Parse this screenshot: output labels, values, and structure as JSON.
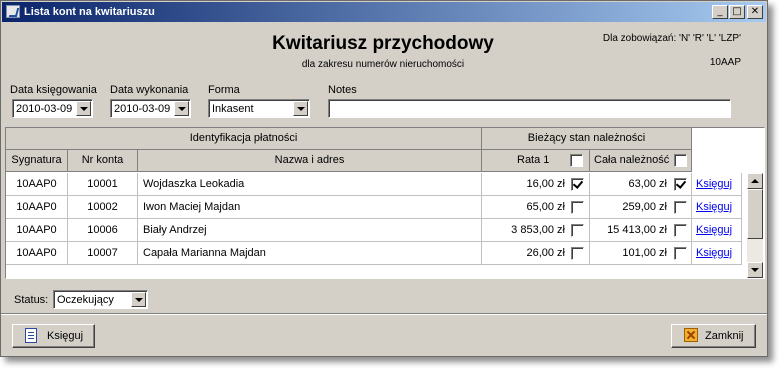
{
  "window": {
    "title": "Lista kont na kwitariuszu"
  },
  "header": {
    "title": "Kwitariusz przychodowy",
    "subtitle": "dla zakresu numerów nieruchomości",
    "obligations": "Dla zobowiązań: 'N' 'R' 'L' 'LZP'",
    "code": "10AAP"
  },
  "filters": {
    "posting_date": {
      "label": "Data księgowania",
      "value": "2010-03-09"
    },
    "execution_date": {
      "label": "Data wykonania",
      "value": "2010-03-09"
    },
    "form": {
      "label": "Forma",
      "value": "Inkasent"
    },
    "notes": {
      "label": "Notes",
      "value": ""
    }
  },
  "table": {
    "group_headers": {
      "identification": "Identyfikacja płatności",
      "current_state": "Bieżący stan należności"
    },
    "columns": {
      "signature": "Sygnatura",
      "account_no": "Nr konta",
      "name_address": "Nazwa i adres",
      "installment": "Rata 1",
      "total": "Cała należność"
    },
    "rows": [
      {
        "signature": "10AAP0",
        "account_no": "10001",
        "name": "Wojdaszka Leokadia",
        "installment": "16,00 zł",
        "installment_checked": true,
        "total": "63,00 zł",
        "total_checked": true,
        "action": "Księguj"
      },
      {
        "signature": "10AAP0",
        "account_no": "10002",
        "name": "Iwon Maciej Majdan",
        "installment": "65,00 zł",
        "installment_checked": false,
        "total": "259,00 zł",
        "total_checked": false,
        "action": "Księguj"
      },
      {
        "signature": "10AAP0",
        "account_no": "10006",
        "name": "Biały Andrzej",
        "installment": "3 853,00 zł",
        "installment_checked": false,
        "total": "15 413,00 zł",
        "total_checked": false,
        "action": "Księguj"
      },
      {
        "signature": "10AAP0",
        "account_no": "10007",
        "name": "Capała Marianna Majdan",
        "installment": "26,00 zł",
        "installment_checked": false,
        "total": "101,00 zł",
        "total_checked": false,
        "action": "Księguj"
      }
    ]
  },
  "status": {
    "label": "Status:",
    "value": "Oczekujący"
  },
  "footer": {
    "post_label": "Księguj",
    "close_label": "Zamknij"
  }
}
